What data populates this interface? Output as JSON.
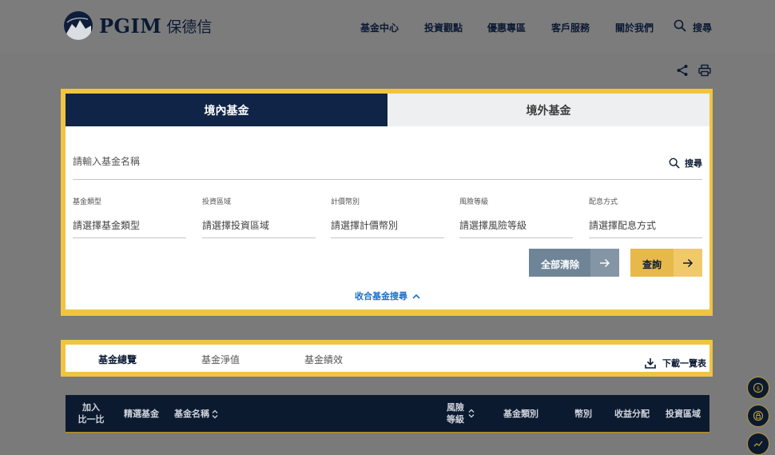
{
  "brand": {
    "name": "PGIM",
    "name_cn": "保德信"
  },
  "nav": {
    "items": [
      "基金中心",
      "投資觀點",
      "優惠專區",
      "客戶服務",
      "關於我們"
    ],
    "search_label": "搜尋"
  },
  "fund_tabs": {
    "active": "境內基金",
    "inactive": "境外基金"
  },
  "search": {
    "placeholder": "請輸入基金名稱",
    "button_label": "搜尋"
  },
  "filters": [
    {
      "label": "基金類型",
      "value": "請選擇基金類型"
    },
    {
      "label": "投資區域",
      "value": "請選擇投資區域"
    },
    {
      "label": "計價幣別",
      "value": "請選擇計價幣別"
    },
    {
      "label": "風險等級",
      "value": "請選擇風險等級"
    },
    {
      "label": "配息方式",
      "value": "請選擇配息方式"
    }
  ],
  "buttons": {
    "clear": "全部清除",
    "query": "查詢"
  },
  "collapse_label": "收合基金搜尋",
  "sub_tabs": {
    "items": [
      "基金總覽",
      "基金淨值",
      "基金績效"
    ],
    "active_index": 0
  },
  "download_label": "下載一覽表",
  "table_header": {
    "compare_line1": "加入",
    "compare_line2": "比一比",
    "featured": "精選基金",
    "fund_name": "基金名稱",
    "risk_line1": "風險",
    "risk_line2": "等級",
    "fund_type": "基金類別",
    "currency": "幣別",
    "distribution": "收益分配",
    "region": "投資區域"
  },
  "colors": {
    "navy": "#0f2446",
    "highlight": "#f0c441",
    "link": "#1d6fc8",
    "clear_button": "#6f8497",
    "query_button": "#e6b94a"
  }
}
